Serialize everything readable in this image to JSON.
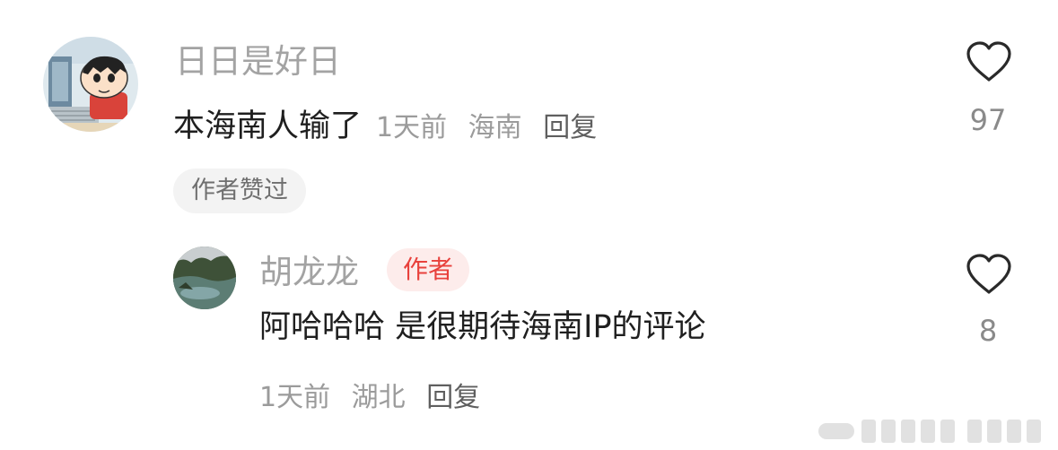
{
  "comment1": {
    "username": "日日是好日",
    "content": "本海南人输了",
    "time": "1天前",
    "location": "海南",
    "reply": "回复",
    "like_count": "97",
    "author_liked": "作者赞过"
  },
  "reply1": {
    "username": "胡龙龙",
    "author_badge": "作者",
    "content": "阿哈哈哈 是很期待海南IP的评论",
    "time": "1天前",
    "location": "湖北",
    "reply": "回复",
    "like_count": "8"
  },
  "icons": {
    "like": "heart-outline-icon"
  },
  "colors": {
    "author_badge_bg": "#fdeceb",
    "author_badge_text": "#e8413c",
    "primary_text": "#1f1f1f",
    "secondary_text": "#9b9b9b"
  }
}
